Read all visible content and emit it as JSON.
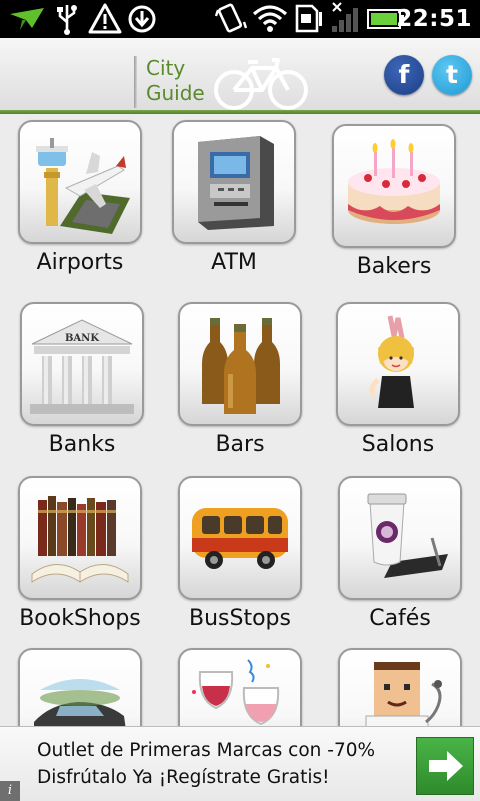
{
  "status_bar": {
    "time": "22:51",
    "icons": [
      "notification-arrow-icon",
      "usb-icon",
      "warning-icon",
      "download-icon",
      "vibrate-icon",
      "wifi-icon",
      "sd-card-icon",
      "signal-icon",
      "battery-icon"
    ]
  },
  "header": {
    "logo_line1": "City",
    "logo_line2": "Guide",
    "facebook_label": "f",
    "twitter_label": "t",
    "colors": {
      "brand_green": "#5b8a2d",
      "rule_green": "#4f8428",
      "facebook": "#2a4f9c",
      "twitter": "#2aa8e0"
    }
  },
  "categories": [
    {
      "label": "Airports",
      "icon": "airport-icon"
    },
    {
      "label": "ATM",
      "icon": "atm-icon"
    },
    {
      "label": "Bakers",
      "icon": "cake-icon"
    },
    {
      "label": "Banks",
      "icon": "bank-icon"
    },
    {
      "label": "Bars",
      "icon": "beer-bottles-icon"
    },
    {
      "label": "Salons",
      "icon": "salon-icon"
    },
    {
      "label": "BookShops",
      "icon": "books-icon"
    },
    {
      "label": "BusStops",
      "icon": "bus-icon"
    },
    {
      "label": "Cafés",
      "icon": "coffee-cup-icon"
    },
    {
      "label": "",
      "icon": "car-icon"
    },
    {
      "label": "",
      "icon": "wine-glasses-icon"
    },
    {
      "label": "",
      "icon": "doctor-icon"
    }
  ],
  "ad": {
    "line1": "Outlet de Primeras Marcas con -70%",
    "line2": "Disfrútalo Ya ¡Regístrate Gratis!",
    "info_label": "i",
    "cta_icon": "arrow-right-icon"
  }
}
